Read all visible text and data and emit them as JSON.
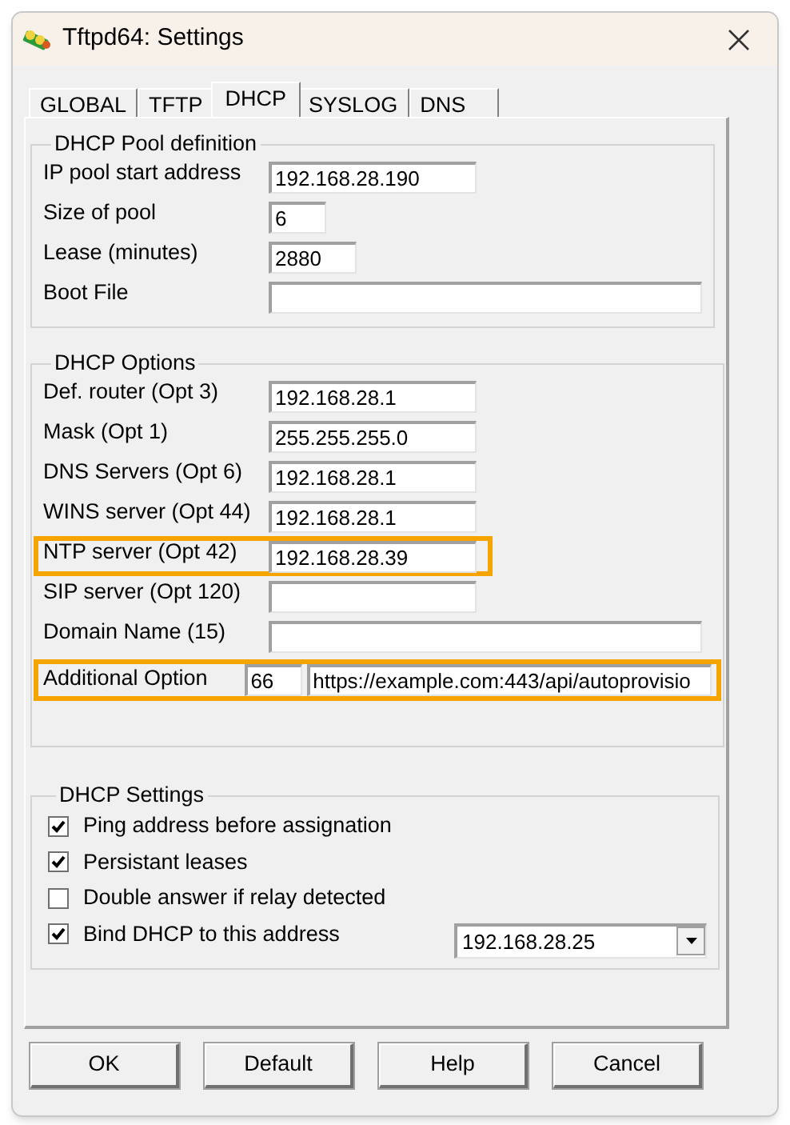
{
  "window": {
    "title": "Tftpd64: Settings"
  },
  "tabs": [
    {
      "label": "GLOBAL",
      "selected": false
    },
    {
      "label": "TFTP",
      "selected": false
    },
    {
      "label": "DHCP",
      "selected": true
    },
    {
      "label": "SYSLOG",
      "selected": false
    },
    {
      "label": "DNS",
      "selected": false
    }
  ],
  "pool": {
    "title": "DHCP Pool definition",
    "rows": [
      {
        "label": "IP pool start address",
        "value": "192.168.28.190"
      },
      {
        "label": "Size of pool",
        "value": "6"
      },
      {
        "label": "Lease (minutes)",
        "value": "2880"
      },
      {
        "label": "Boot File"
      }
    ]
  },
  "options": {
    "title": "DHCP Options",
    "rows": [
      {
        "kind": "field",
        "label": "Def. router (Opt 3)",
        "value": "192.168.28.1",
        "highlighted": false
      },
      {
        "kind": "field",
        "label": "Mask (Opt 1)",
        "value": "255.255.255.0",
        "highlighted": false
      },
      {
        "kind": "field",
        "label": "DNS Servers (Opt 6)",
        "value": "192.168.28.1",
        "highlighted": false
      },
      {
        "kind": "field",
        "label": "WINS server (Opt 44)",
        "value": "192.168.28.1",
        "highlighted": false
      },
      {
        "kind": "field",
        "label": "NTP server (Opt 42)",
        "value": "192.168.28.39",
        "highlighted": true
      },
      {
        "kind": "field",
        "label": "SIP server (Opt 120)",
        "highlighted": false
      },
      {
        "kind": "field",
        "label": "Domain Name (15)",
        "highlighted": false
      },
      {
        "kind": "option",
        "label": "Additional Option",
        "code": "66",
        "value": "https://example.com:443/api/autoprovisio",
        "highlighted": true
      }
    ]
  },
  "settings": {
    "title": "DHCP Settings",
    "items": [
      {
        "label": "Ping address before assignation",
        "checked": true
      },
      {
        "label": "Persistant leases",
        "checked": true
      },
      {
        "label": "Double answer if relay detected",
        "checked": false
      },
      {
        "label": "Bind DHCP to this address",
        "checked": true,
        "address": "192.168.28.25"
      }
    ]
  },
  "buttons": [
    "OK",
    "Default",
    "Help",
    "Cancel"
  ]
}
